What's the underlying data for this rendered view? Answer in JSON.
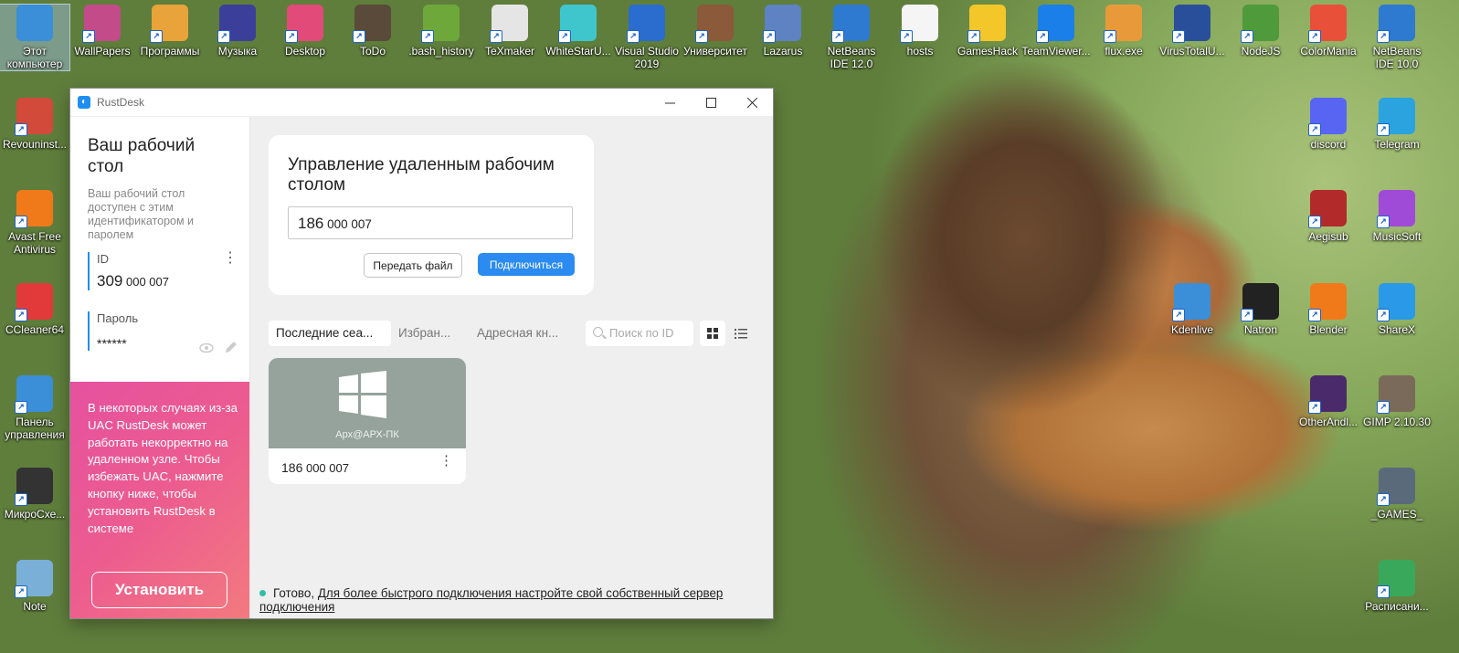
{
  "desktop": {
    "icons": [
      {
        "label": "Этот компьютер",
        "icon": "computer-icon",
        "color": "#3a8fd8"
      },
      {
        "label": "WallPapers",
        "icon": "images-icon",
        "color": "#c44b8a"
      },
      {
        "label": "Программы",
        "icon": "apps-icon",
        "color": "#e8a33a"
      },
      {
        "label": "Музыка",
        "icon": "book-icon",
        "color": "#3c3f9a"
      },
      {
        "label": "Desktop",
        "icon": "gradient-icon",
        "color": "#e24a7a"
      },
      {
        "label": "ToDo",
        "icon": "poster-icon",
        "color": "#5a4a3a"
      },
      {
        "label": ".bash_history",
        "icon": "notepad-icon",
        "color": "#6fa83a"
      },
      {
        "label": "TeXmaker",
        "icon": "tex-icon",
        "color": "#e5e5e5"
      },
      {
        "label": "WhiteStarU...",
        "icon": "star-icon",
        "color": "#3fc6cc"
      },
      {
        "label": "Visual Studio 2019",
        "icon": "window-icon",
        "color": "#2b6ccf"
      },
      {
        "label": "Университет",
        "icon": "library-icon",
        "color": "#8a5a3a"
      },
      {
        "label": "Lazarus",
        "icon": "leopard-icon",
        "color": "#5e82c2"
      },
      {
        "label": "NetBeans IDE 12.0",
        "icon": "netbeans-icon",
        "color": "#2e7ad0"
      },
      {
        "label": "hosts",
        "icon": "file-icon",
        "color": "#f5f5f5"
      },
      {
        "label": "GamesHack",
        "icon": "pacman-icon",
        "color": "#f3c62a"
      },
      {
        "label": "TeamViewer...",
        "icon": "teamviewer-icon",
        "color": "#1a7fe8"
      },
      {
        "label": "flux.exe",
        "icon": "flux-icon",
        "color": "#e89a3a"
      },
      {
        "label": "VirusTotalU...",
        "icon": "virustotal-icon",
        "color": "#2a4f9a"
      },
      {
        "label": "NodeJS",
        "icon": "nodejs-icon",
        "color": "#4f9a3a"
      },
      {
        "label": "ColorMania",
        "icon": "rainbow-icon",
        "color": "#e8503a"
      },
      {
        "label": "NetBeans IDE 10.0",
        "icon": "netbeans-icon",
        "color": "#2e7ad0"
      },
      {
        "label": "Revouninst...",
        "icon": "revo-icon",
        "color": "#d24a3a"
      },
      {
        "label": "Avast Free Antivirus",
        "icon": "avast-icon",
        "color": "#f07a1a"
      },
      {
        "label": "CCleaner64",
        "icon": "ccleaner-icon",
        "color": "#e23a3a"
      },
      {
        "label": "Панель управления",
        "icon": "control-panel-icon",
        "color": "#3a8fd8"
      },
      {
        "label": "МикроСхе...",
        "icon": "chip-icon",
        "color": "#333333"
      },
      {
        "label": "Note",
        "icon": "note-icon",
        "color": "#7ab0d8"
      },
      {
        "label": "discord",
        "icon": "discord-icon",
        "color": "#5865f2"
      },
      {
        "label": "Telegram",
        "icon": "telegram-icon",
        "color": "#2aa3de"
      },
      {
        "label": "Aegisub",
        "icon": "aegisub-icon",
        "color": "#b22a2a"
      },
      {
        "label": "MusicSoft",
        "icon": "flask-icon",
        "color": "#a04ad8"
      },
      {
        "label": "Kdenlive",
        "icon": "kdenlive-icon",
        "color": "#3a8fd8"
      },
      {
        "label": "Natron",
        "icon": "natron-icon",
        "color": "#222222"
      },
      {
        "label": "Blender",
        "icon": "blender-icon",
        "color": "#f07a1a"
      },
      {
        "label": "ShareX",
        "icon": "sharex-icon",
        "color": "#2a9ae8"
      },
      {
        "label": "OtherAndl...",
        "icon": "pixel-icon",
        "color": "#4a2a6a"
      },
      {
        "label": "GIMP 2.10.30",
        "icon": "gimp-icon",
        "color": "#7a6a5a"
      },
      {
        "label": "_GAMES_",
        "icon": "shield-icon",
        "color": "#5a6a7a"
      },
      {
        "label": "Расписани...",
        "icon": "spreadsheet-icon",
        "color": "#3aa85a"
      }
    ]
  },
  "window": {
    "title": "RustDesk",
    "controls": {
      "minimize": "—",
      "maximize": "☐",
      "close": "✕"
    }
  },
  "left": {
    "title": "Ваш рабочий стол",
    "description": "Ваш рабочий стол доступен с этим идентификатором и паролем",
    "id_label": "ID",
    "id_prefix": "309",
    "id_rest": " 000 007",
    "password_label": "Пароль",
    "password_value": "******",
    "uac_text": "В некоторых случаях из-за UAC RustDesk может работать некорректно на удаленном узле. Чтобы избежать UAC, нажмите кнопку ниже, чтобы установить RustDesk в системе",
    "install_label": "Установить"
  },
  "connect": {
    "title": "Управление удаленным рабочим столом",
    "id_prefix": "186",
    "id_rest": " 000 007",
    "transfer_label": "Передать файл",
    "connect_label": "Подключиться",
    "accent": "#2b8bf0"
  },
  "tabs": [
    {
      "label": "Последние сеа..."
    },
    {
      "label": "Избран..."
    },
    {
      "label": "Адресная кн..."
    }
  ],
  "search": {
    "placeholder": "Поиск по ID"
  },
  "peer": {
    "host": "Арх@АРХ-ПК",
    "id_prefix": "186",
    "id_rest": " 000 007"
  },
  "status": {
    "ready": "Готово,",
    "link": "Для более быстрого подключения настройте свой собственный сервер подключения",
    "dot_color": "#32bea6"
  }
}
